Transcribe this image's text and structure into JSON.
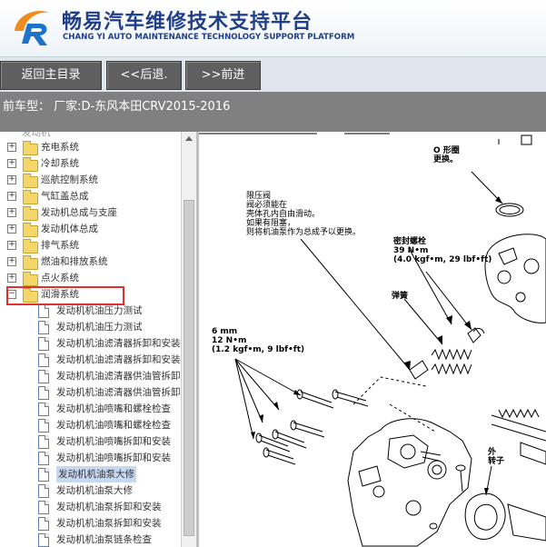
{
  "header": {
    "title_cn": "畅易汽车维修技术支持平台",
    "title_en": "CHANG YI AUTO MAINTENANCE TECHNOLOGY SUPPORT PLATFORM",
    "logo_icon": "chang-yi-logo-icon"
  },
  "nav": {
    "home_label": "返回主目录",
    "back_label": "<<后退.",
    "forward_label": ">>前进"
  },
  "vehicle": {
    "text": "前车型：  厂家:D-东风本田CRV2015-2016"
  },
  "tree": {
    "partial_top": "发动机",
    "folders": [
      "充电系统",
      "冷却系统",
      "巡航控制系统",
      "气缸盖总成",
      "发动机总成与支座",
      "发动机体总成",
      "排气系统",
      "燃油和排放系统",
      "点火系统",
      "润滑系统"
    ],
    "documents": [
      "发动机机油压力测试",
      "发动机机油压力测试",
      "发动机机油滤清器拆卸和安装",
      "发动机机油滤清器拆卸和安装",
      "发动机机油滤清器供油管拆卸和",
      "发动机机油滤清器供油管拆卸和",
      "发动机机油喷嘴和螺栓检查",
      "发动机机油喷嘴和螺栓检查",
      "发动机机油喷嘴拆卸和安装",
      "发动机机油喷嘴拆卸和安装",
      "发动机机油泵大修",
      "发动机机油泵大修",
      "发动机机油泵拆卸和安装",
      "发动机机油泵拆卸和安装",
      "发动机机油泵链条检查"
    ],
    "selected_index": 10,
    "colors": {
      "highlight": "#e03030",
      "selected_bg": "#c8d8f0"
    }
  },
  "diagram": {
    "o_ring": "O 形圈\n更换。",
    "relief_valve": "限压阀\n阀必须能在\n壳体孔内自由滑动。\n如果有阻塞，\n则将机油泵作为总成予以更换。",
    "sealing_bolt": "密封螺栓\n39 N•m\n(4.0 kgf•m, 29 lbf•ft)",
    "spring": "弹簧",
    "small_bolts": "6 mm\n12 N•m\n(1.2 kgf•m, 9 lbf•ft)",
    "outer_rotor": "外\n转子"
  }
}
